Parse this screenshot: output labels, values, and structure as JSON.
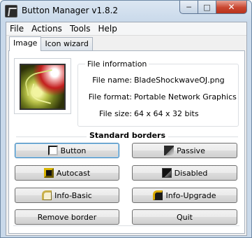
{
  "window": {
    "title": "Button Manager v1.8.2"
  },
  "menu": [
    {
      "label": "File"
    },
    {
      "label": "Actions"
    },
    {
      "label": "Tools"
    },
    {
      "label": "Help"
    }
  ],
  "tabs": [
    {
      "label": "Image",
      "active": true
    },
    {
      "label": "Icon wizard",
      "active": false
    }
  ],
  "file_info": {
    "legend": "File information",
    "rows": [
      {
        "label": "File name:",
        "value": "BladeShockwaveOJ.png"
      },
      {
        "label": "File format:",
        "value": "Portable Network Graphics"
      },
      {
        "label": "File size:",
        "value": "64 x 64 x 32 bits"
      }
    ]
  },
  "standard_borders": {
    "legend": "Standard borders",
    "buttons": [
      {
        "label": "Button",
        "icon": "button-border-icon"
      },
      {
        "label": "Passive",
        "icon": "passive-border-icon"
      },
      {
        "label": "Autocast",
        "icon": "autocast-border-icon"
      },
      {
        "label": "Disabled",
        "icon": "disabled-border-icon"
      },
      {
        "label": "Info-Basic",
        "icon": "info-basic-border-icon"
      },
      {
        "label": "Info-Upgrade",
        "icon": "info-upgrade-border-icon"
      }
    ]
  },
  "footer": {
    "remove_border": "Remove border",
    "quit": "Quit"
  },
  "colors": {
    "titlebar": "#c9d9ea",
    "close_button": "#c8452f",
    "focus_border": "#3c7fb1"
  }
}
